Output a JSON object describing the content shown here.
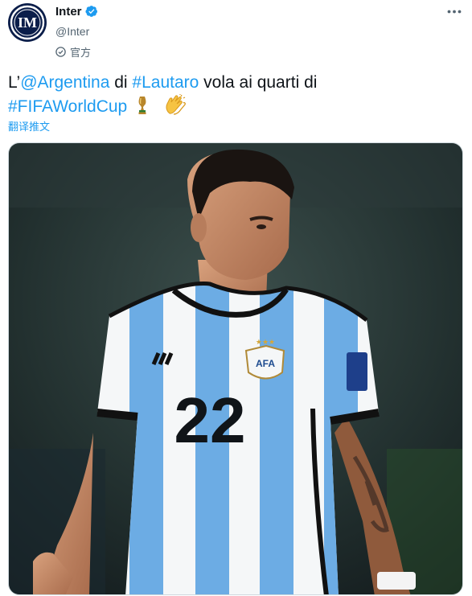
{
  "author": {
    "display_name": "Inter",
    "handle": "@Inter",
    "label": "官方"
  },
  "tweet": {
    "prefix": "L’",
    "mention": "@Argentina",
    "text_di": " di ",
    "hashtag_player": "#Lautaro",
    "text_rest": " vola ai quarti di",
    "hashtag_cup": "#FIFAWorldCup"
  },
  "translate_label": "翻译推文",
  "media": {
    "shirt_number": "22",
    "crest_text": "AFA"
  },
  "colors": {
    "link": "#1d9bf0",
    "verified": "#1d9bf0",
    "inter_navy": "#0b1e4a",
    "argentina_blue": "#6cace4"
  },
  "icons": {
    "verified": "verified-badge-icon",
    "official": "official-label-icon",
    "more": "more-options-icon",
    "trophy": "trophy-emoji",
    "clap": "clapping-hands-emoji"
  }
}
